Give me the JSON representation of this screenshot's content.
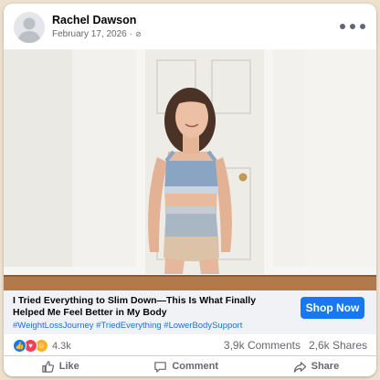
{
  "post": {
    "author": "Rachel Dawson",
    "date": "February 17, 2026",
    "privacy_icon": "globe-icon"
  },
  "photo": {
    "subject": "woman-in-sports-bra-and-shapewear"
  },
  "link": {
    "title": "I Tried Everything to Slim Down—This Is What Finally Helped Me Feel Better in My Body",
    "hashtags": "#WeightLossJourney #TriedEverything #LowerBodySupport",
    "cta": "Shop Now"
  },
  "stats": {
    "reaction_count": "4.3k",
    "comments": "3,9k Comments",
    "shares": "2,6k Shares"
  },
  "actions": {
    "like": "Like",
    "comment": "Comment",
    "share": "Share"
  },
  "colors": {
    "brand_blue": "#1877f2",
    "hashtag_blue": "#216fdb",
    "muted_text": "#65676b",
    "page_background": "#ece1cf"
  }
}
